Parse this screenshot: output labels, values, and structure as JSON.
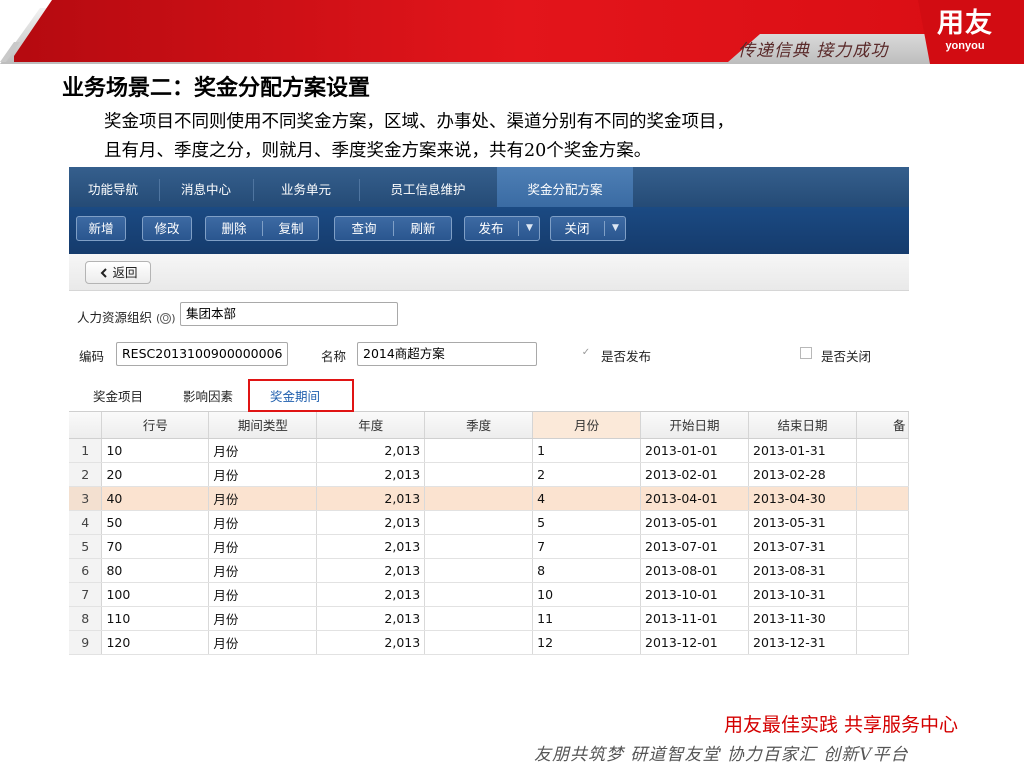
{
  "banner": {
    "slogan": "传递信典 接力成功",
    "logo_cn": "用友",
    "logo_en": "yonyou",
    "brand_red": "#e60012"
  },
  "slide": {
    "title": "业务场景二：奖金分配方案设置",
    "desc_line1": "奖金项目不同则使用不同奖金方案，区域、办事处、渠道分别有不同的奖金项目，",
    "desc_line2": "且有月、季度之分，则就月、季度奖金方案来说，共有20个奖金方案。"
  },
  "app": {
    "nav_tabs": [
      "功能导航",
      "消息中心",
      "业务单元",
      "员工信息维护",
      "奖金分配方案"
    ],
    "toolbar": {
      "add": "新增",
      "edit": "修改",
      "delete": "删除",
      "copy": "复制",
      "query": "查询",
      "refresh": "刷新",
      "publish": "发布",
      "close": "关闭",
      "caret": "▼"
    },
    "back_label": "返回",
    "form": {
      "org_label": "人力资源组织",
      "org_hotkey": "O",
      "org_value": "集团本部",
      "code_label": "编码",
      "code_value": "RESC2013100900000006",
      "name_label": "名称",
      "name_value": "2014商超方案",
      "published_label": "是否发布",
      "published_check": "✓",
      "closed_label": "是否关闭"
    },
    "sub_tabs": [
      "奖金项目",
      "影响因素",
      "奖金期间"
    ],
    "grid": {
      "columns": [
        "行号",
        "期间类型",
        "年度",
        "季度",
        "月份",
        "开始日期",
        "结束日期",
        "备"
      ],
      "rows": [
        {
          "idx": "1",
          "line": "10",
          "type": "月份",
          "year": "2,013",
          "quarter": "",
          "month": "1",
          "start": "2013-01-01",
          "end": "2013-01-31"
        },
        {
          "idx": "2",
          "line": "20",
          "type": "月份",
          "year": "2,013",
          "quarter": "",
          "month": "2",
          "start": "2013-02-01",
          "end": "2013-02-28"
        },
        {
          "idx": "3",
          "line": "40",
          "type": "月份",
          "year": "2,013",
          "quarter": "",
          "month": "4",
          "start": "2013-04-01",
          "end": "2013-04-30"
        },
        {
          "idx": "4",
          "line": "50",
          "type": "月份",
          "year": "2,013",
          "quarter": "",
          "month": "5",
          "start": "2013-05-01",
          "end": "2013-05-31"
        },
        {
          "idx": "5",
          "line": "70",
          "type": "月份",
          "year": "2,013",
          "quarter": "",
          "month": "7",
          "start": "2013-07-01",
          "end": "2013-07-31"
        },
        {
          "idx": "6",
          "line": "80",
          "type": "月份",
          "year": "2,013",
          "quarter": "",
          "month": "8",
          "start": "2013-08-01",
          "end": "2013-08-31"
        },
        {
          "idx": "7",
          "line": "100",
          "type": "月份",
          "year": "2,013",
          "quarter": "",
          "month": "10",
          "start": "2013-10-01",
          "end": "2013-10-31"
        },
        {
          "idx": "8",
          "line": "110",
          "type": "月份",
          "year": "2,013",
          "quarter": "",
          "month": "11",
          "start": "2013-11-01",
          "end": "2013-11-30"
        },
        {
          "idx": "9",
          "line": "120",
          "type": "月份",
          "year": "2,013",
          "quarter": "",
          "month": "12",
          "start": "2013-12-01",
          "end": "2013-12-31"
        }
      ]
    }
  },
  "footer": {
    "red_text": "用友最佳实践  共享服务中心",
    "slogan": "友朋共筑梦  研道智友堂  协力百家汇  创新V平台"
  }
}
